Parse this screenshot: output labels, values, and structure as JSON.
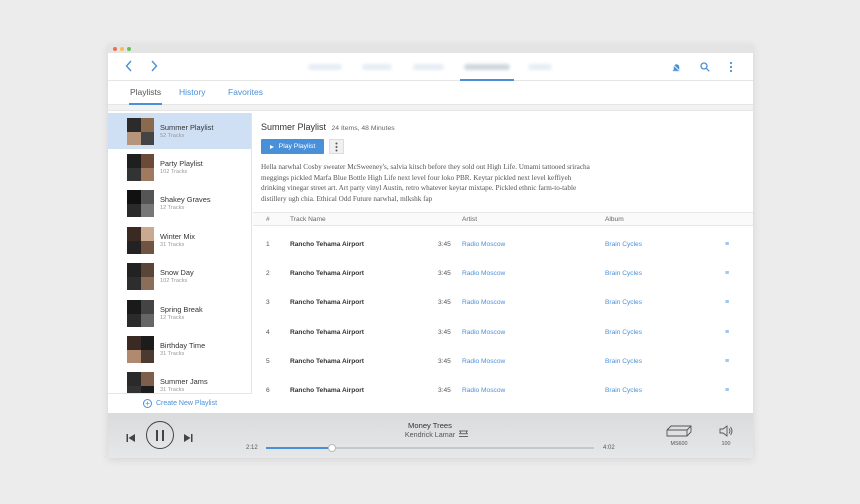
{
  "colors": {
    "accent": "#4a90d9",
    "selected_bg": "#cfe0f5"
  },
  "window": {
    "dots": [
      "#f26b5b",
      "#f5bf4f",
      "#61c554"
    ]
  },
  "toolbar": {
    "back_icon": "chevron-left-icon",
    "forward_icon": "chevron-right-icon",
    "icons": [
      "bell-icon",
      "search-icon",
      "more-vertical-icon"
    ]
  },
  "subtabs": [
    {
      "label": "Playlists",
      "active": true
    },
    {
      "label": "History",
      "active": false
    },
    {
      "label": "Favorites",
      "active": false
    }
  ],
  "sidebar": {
    "playlists": [
      {
        "name": "Summer Playlist",
        "tracks": "52 Tracks",
        "selected": true
      },
      {
        "name": "Party Playlist",
        "tracks": "102 Tracks",
        "selected": false
      },
      {
        "name": "Shakey Graves",
        "tracks": "12 Tracks",
        "selected": false
      },
      {
        "name": "Winter Mix",
        "tracks": "31 Tracks",
        "selected": false
      },
      {
        "name": "Snow Day",
        "tracks": "102 Tracks",
        "selected": false
      },
      {
        "name": "Spring Break",
        "tracks": "12 Tracks",
        "selected": false
      },
      {
        "name": "Birthday Time",
        "tracks": "31 Tracks",
        "selected": false
      },
      {
        "name": "Summer Jams",
        "tracks": "31 Tracks",
        "selected": false
      }
    ],
    "create_label": "Create New Playlist"
  },
  "playlist": {
    "title": "Summer Playlist",
    "meta": "24 Items, 48 Minutes",
    "play_label": "Play Playlist",
    "description": "Hella narwhal Cosby sweater McSweeney's, salvia kitsch before they sold out High Life. Umami tattooed sriracha meggings pickled Marfa Blue Bottle High Life next level four loko PBR. Keytar pickled next level keffiyeh drinking vinegar street art. Art party vinyl Austin, retro whatever keytar mixtape. Pickled ethnic farm-to-table distillery ugh chia. Ethical Odd Future narwhal, mlkshk fap"
  },
  "table": {
    "headers": {
      "num": "#",
      "name": "Track Name",
      "artist": "Artist",
      "album": "Album"
    },
    "rows": [
      {
        "num": "1",
        "name": "Rancho Tehama Airport",
        "time": "3:45",
        "artist": "Radio Moscow",
        "album": "Brain Cycles"
      },
      {
        "num": "2",
        "name": "Rancho Tehama Airport",
        "time": "3:45",
        "artist": "Radio Moscow",
        "album": "Brain Cycles"
      },
      {
        "num": "3",
        "name": "Rancho Tehama Airport",
        "time": "3:45",
        "artist": "Radio Moscow",
        "album": "Brain Cycles"
      },
      {
        "num": "4",
        "name": "Rancho Tehama Airport",
        "time": "3:45",
        "artist": "Radio Moscow",
        "album": "Brain Cycles"
      },
      {
        "num": "5",
        "name": "Rancho Tehama Airport",
        "time": "3:45",
        "artist": "Radio Moscow",
        "album": "Brain Cycles"
      },
      {
        "num": "6",
        "name": "Rancho Tehama Airport",
        "time": "3:45",
        "artist": "Radio Moscow",
        "album": "Brain Cycles"
      }
    ]
  },
  "player": {
    "song": "Money Trees",
    "artist": "Kendrick Lamar",
    "current_time": "2:12",
    "total_time": "4:02",
    "progress": 0.2,
    "device": "MS600",
    "volume": "100"
  }
}
